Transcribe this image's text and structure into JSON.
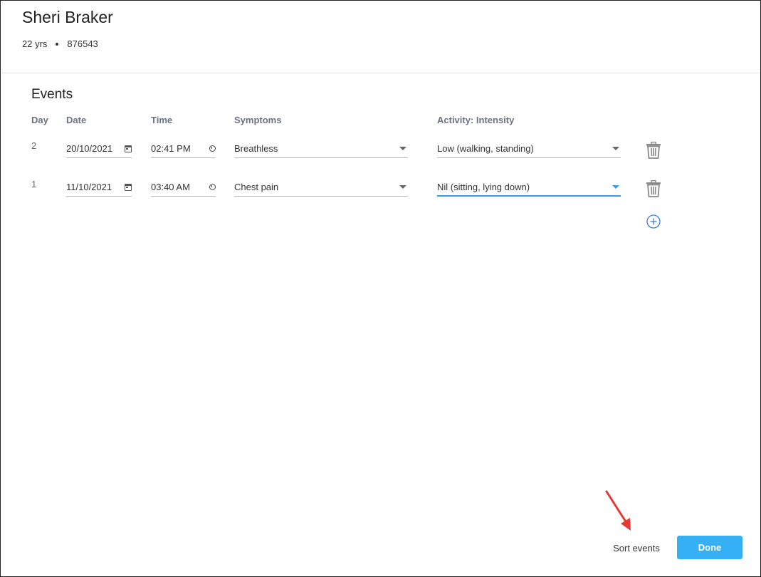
{
  "patient": {
    "name": "Sheri Braker",
    "age": "22 yrs",
    "id": "876543"
  },
  "events": {
    "title": "Events",
    "columns": {
      "day": "Day",
      "date": "Date",
      "time": "Time",
      "symptoms": "Symptoms",
      "activity": "Activity: Intensity"
    },
    "rows": [
      {
        "day": "2",
        "date": "20/10/2021",
        "time": "02:41 PM",
        "symptom": "Breathless",
        "activity": "Low (walking, standing)"
      },
      {
        "day": "1",
        "date": "11/10/2021",
        "time": "03:40 AM",
        "symptom": "Chest pain",
        "activity": "Nil (sitting, lying down)"
      }
    ]
  },
  "footer": {
    "sort_label": "Sort events",
    "done_label": "Done"
  },
  "colors": {
    "accent": "#36b0f5",
    "focus_underline": "#3b9ae8",
    "annotation_arrow": "#e53935"
  },
  "icons": {
    "date_picker": "calendar-icon",
    "time_picker": "clock-icon",
    "dropdown": "chevron-down-icon",
    "delete": "trash-icon",
    "add": "plus-circle-icon"
  }
}
